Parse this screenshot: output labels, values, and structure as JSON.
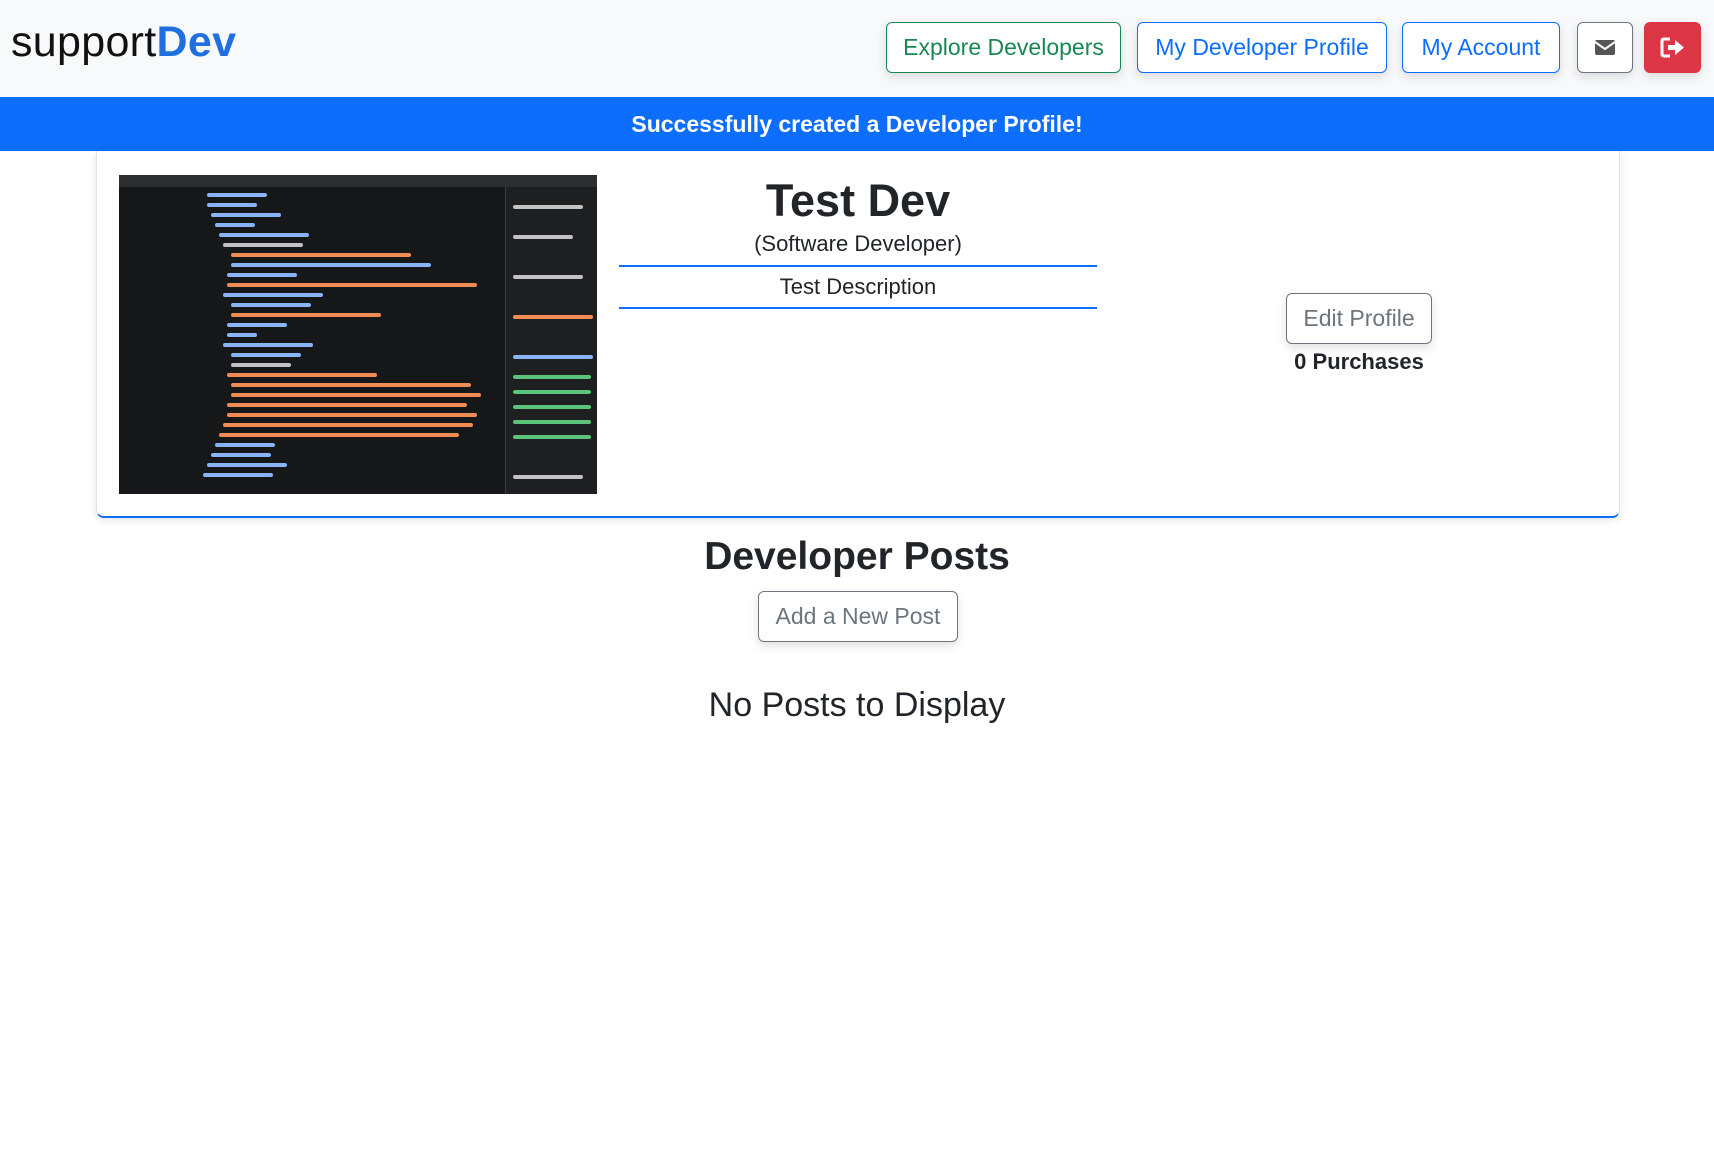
{
  "brand": {
    "part1": "support",
    "part2": "Dev"
  },
  "nav": {
    "explore_label": "Explore Developers",
    "dev_profile_label": "My Developer Profile",
    "account_label": "My Account",
    "messages_icon": "envelope-icon",
    "logout_icon": "sign-out-icon"
  },
  "alert": {
    "message": "Successfully created a Developer Profile!"
  },
  "profile": {
    "image_alt": "code-screenshot",
    "name": "Test Dev",
    "role": "(Software Developer)",
    "description": "Test Description",
    "edit_label": "Edit Profile",
    "purchases": "0 Purchases"
  },
  "posts": {
    "title": "Developer Posts",
    "add_label": "Add a New Post",
    "empty_text": "No Posts to Display"
  },
  "colors": {
    "primary": "#0d6efd",
    "success": "#198754",
    "danger": "#dc3545",
    "secondary": "#6c757d"
  }
}
